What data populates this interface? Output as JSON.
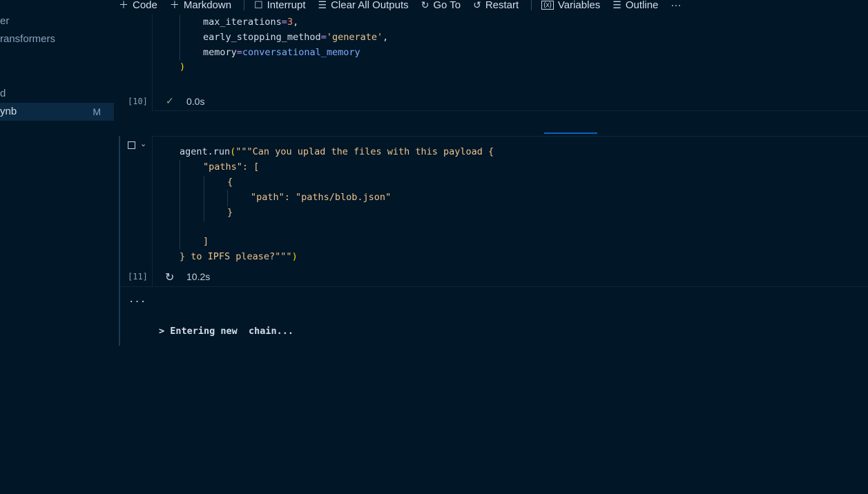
{
  "sidebar": {
    "items": [
      {
        "label": "er"
      },
      {
        "label": "ransformers"
      },
      {
        "label": "d"
      },
      {
        "label": "ynb",
        "badge": "M",
        "selected": true
      }
    ]
  },
  "toolbar": {
    "items": [
      {
        "label": "Code",
        "icon": "plus-icon"
      },
      {
        "label": "Markdown",
        "icon": "plus-icon"
      },
      {
        "label": "Interrupt",
        "icon": "stop-icon"
      },
      {
        "label": "Clear All Outputs",
        "icon": "clear-all-icon"
      },
      {
        "label": "Go To",
        "icon": "sync-icon"
      },
      {
        "label": "Restart",
        "icon": "restart-icon"
      },
      {
        "label": "Variables",
        "icon": "variables-icon"
      },
      {
        "label": "Outline",
        "icon": "outline-icon"
      }
    ],
    "more": "···"
  },
  "cells": [
    {
      "exec": "[10]",
      "status": "success",
      "time": "0.0s",
      "code": [
        "max_iterations",
        "=",
        "3",
        ",",
        "early_stopping_method",
        "=",
        "'generate'",
        ",",
        "memory",
        "=",
        "conversational_memory",
        ")"
      ]
    },
    {
      "exec": "[11]",
      "status": "running",
      "time": "10.2s",
      "code": [
        "agent.run",
        "(",
        "\"\"\"Can you uplad the files with this payload {",
        "\"paths\": [",
        "{",
        "\"path\": \"paths/blob.json\"",
        "}",
        "]",
        "} to IPFS please?\"\"\"",
        ")"
      ],
      "output": {
        "ellipsis": "...",
        "text": "> Entering new  chain..."
      }
    }
  ],
  "colors": {
    "background": "#011627",
    "accent": "#0b63c1",
    "string": "#ecc48d",
    "number": "#f78c6c",
    "variable": "#82aaff"
  }
}
